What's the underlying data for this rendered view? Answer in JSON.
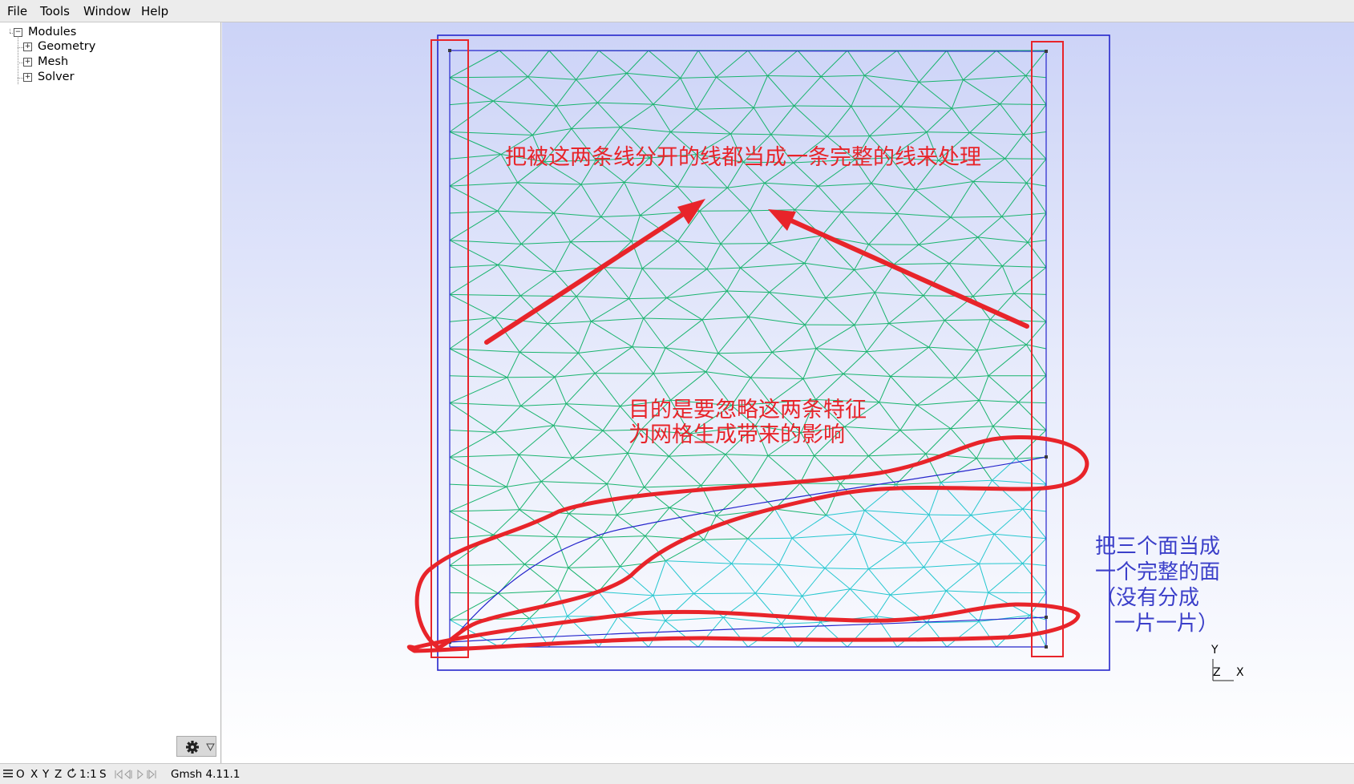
{
  "menu": {
    "file": "File",
    "tools": "Tools",
    "window": "Window",
    "help": "Help"
  },
  "tree": {
    "root": "Modules",
    "items": [
      "Geometry",
      "Mesh",
      "Solver"
    ]
  },
  "annotations": {
    "top": "把被这两条线分开的线都当成一条完整的线来处理",
    "middle_line1": "目的是要忽略这两条特征",
    "middle_line2": "为网格生成带来的影响",
    "right_line1": "把三个面当成",
    "right_line2": "一个完整的面",
    "right_line3": "（没有分成",
    "right_line4": "一片一片）"
  },
  "axes": {
    "y": "Y",
    "z": "Z",
    "x": "X"
  },
  "statusbar": {
    "view_buttons": [
      "O",
      "X",
      "Y",
      "Z"
    ],
    "scale": "1:1",
    "select": "S",
    "app_version": "Gmsh 4.11.1"
  },
  "colors": {
    "mesh_green": "#19b46e",
    "mesh_cyan": "#25c7cf",
    "boundary_blue": "#2525cc",
    "annotation_red": "#e8242a",
    "annotation_blue": "#3b3fc9"
  }
}
